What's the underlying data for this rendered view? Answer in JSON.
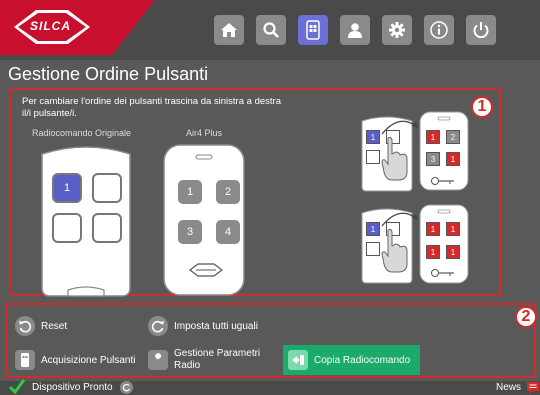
{
  "header": {
    "logo_text": "SILCA",
    "icons": [
      "home-icon",
      "search-icon",
      "remote-icon",
      "user-icon",
      "gear-icon",
      "info-icon",
      "power-icon"
    ],
    "colors": {
      "accent_active": "#6b6fd6",
      "brand_red": "#c8102e"
    }
  },
  "page": {
    "title": "Gestione Ordine Pulsanti",
    "instruction": "Per cambiare l'ordine dei pulsanti trascina da sinistra a destra il/i pulsante/i.",
    "original_label": "Radiocomando Originale",
    "target_label": "Air4 Plus",
    "original_buttons": [
      "1",
      "",
      "",
      ""
    ],
    "target_buttons": [
      "1",
      "2",
      "3",
      "4"
    ],
    "badge1": "1",
    "badge2": "2"
  },
  "illustration": {
    "top_left_buttons": [
      "1",
      ""
    ],
    "top_right_buttons": [
      "1",
      "2",
      "3",
      "1"
    ],
    "bottom_left_buttons": [
      "1",
      ""
    ],
    "bottom_right_buttons": [
      "1",
      "1",
      "1",
      "1"
    ]
  },
  "actions": {
    "reset": "Reset",
    "set_all_equal": "Imposta tutti uguali",
    "acquire_buttons": "Acquisizione Pulsanti",
    "manage_params": "Gestione Parametri Radio",
    "copy_remote": "Copia Radiocomando"
  },
  "status": {
    "device_ready": "Dispositivo Pronto",
    "news": "News",
    "colors": {
      "ok": "#2ecc40",
      "copy_button": "#1aaa6a",
      "border": "#d42a2a"
    }
  }
}
